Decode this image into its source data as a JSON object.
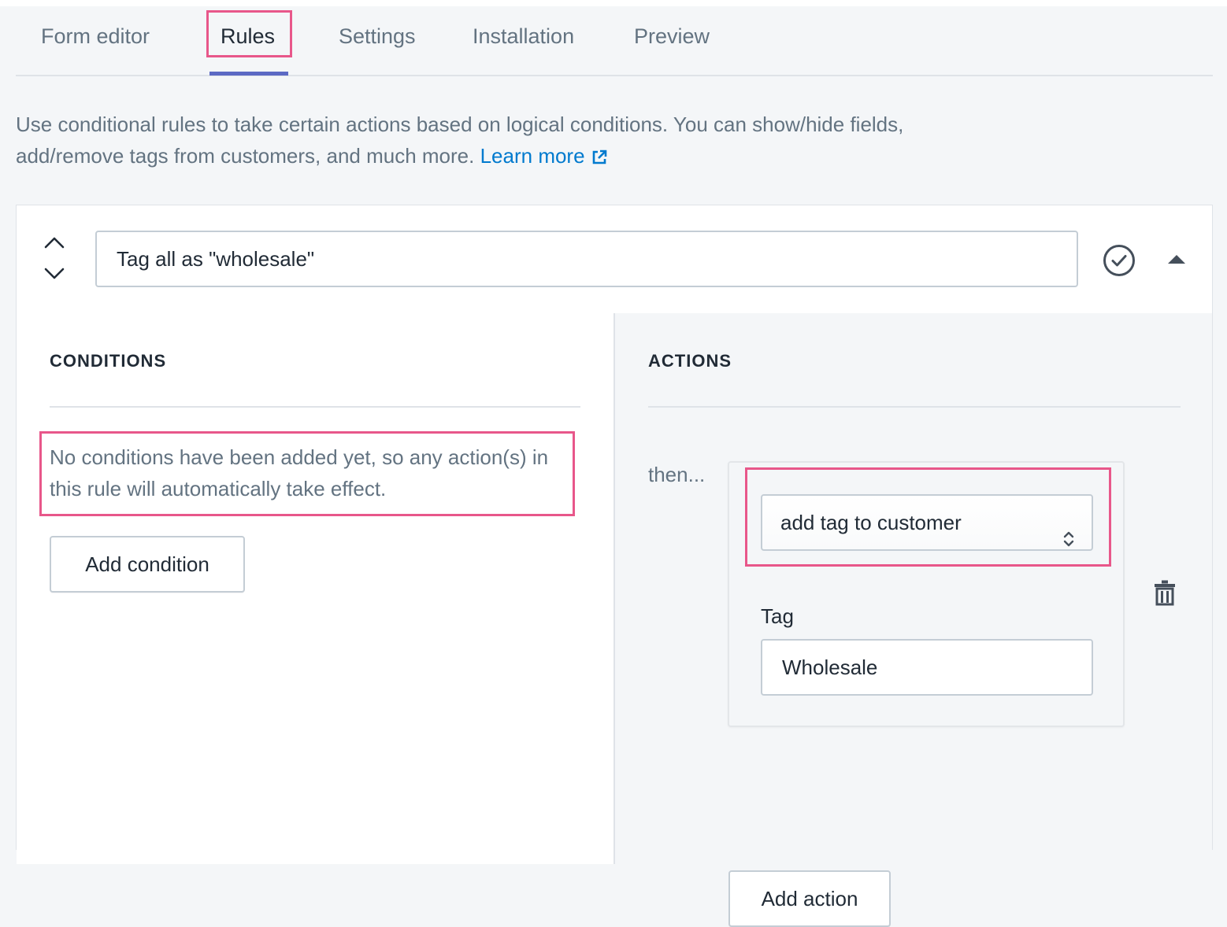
{
  "tabs": [
    {
      "label": "Form editor"
    },
    {
      "label": "Rules"
    },
    {
      "label": "Settings"
    },
    {
      "label": "Installation"
    },
    {
      "label": "Preview"
    }
  ],
  "active_tab": "Rules",
  "intro": {
    "text": "Use conditional rules to take certain actions based on logical conditions. You can show/hide fields, add/remove tags from customers, and much more.",
    "link_label": "Learn more"
  },
  "rule": {
    "name": "Tag all as \"wholesale\""
  },
  "conditions": {
    "title": "CONDITIONS",
    "empty_message": "No conditions have been added yet, so any action(s) in this rule will automatically take effect.",
    "add_button": "Add condition"
  },
  "actions": {
    "title": "ACTIONS",
    "then_label": "then...",
    "action_type": "add tag to customer",
    "tag_label": "Tag",
    "tag_value": "Wholesale",
    "add_button": "Add action"
  },
  "colors": {
    "accent": "#5c6ac4",
    "link": "#007ace",
    "highlight": "#e8578a",
    "border": "#c4cdd5",
    "muted_text": "#637381",
    "background": "#f4f6f8"
  }
}
